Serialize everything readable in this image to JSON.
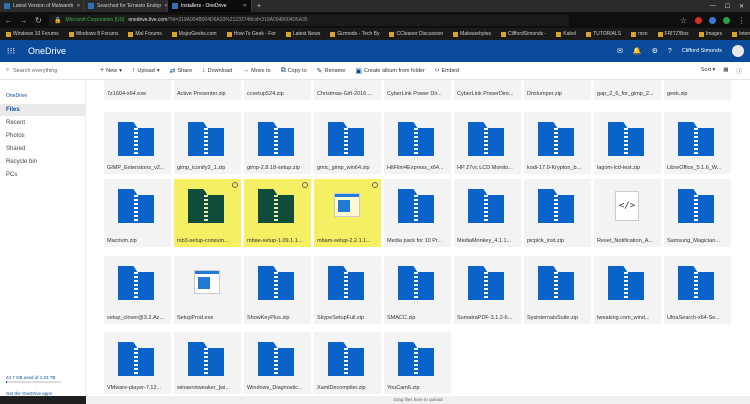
{
  "browser": {
    "tabs": [
      {
        "label": "Latest Version of Malwareb",
        "active": false
      },
      {
        "label": "Searched for 'Ernesto Endop",
        "active": false
      },
      {
        "label": "Installers - OneDrive",
        "active": true
      }
    ],
    "secure_label": "Microsoft Corporation [US]",
    "url_host": "onedrive.live.com",
    "url_path": "/?id=319A004B004D6A33%21232748cid=319A0048004D6A35",
    "bookmarks": [
      "Windows 10 Forums",
      "Windows 8 Forums",
      "Mal Forums",
      "MajorGeeks.com",
      "How-To Geek - For",
      "Latest News",
      "Gizmodo - Tech By",
      "CCleaner Discussion",
      "Malwarebytes",
      "CliffordSimonds -",
      "Kabel",
      "TUTORIALS",
      "msn",
      "FRITZ!Box",
      "Images",
      "Internet Archive"
    ]
  },
  "onedrive": {
    "brand": "OneDrive",
    "user": "Clifford Simonds",
    "search_placeholder": "Search everything",
    "commands": [
      {
        "icon": "+",
        "label": "New",
        "caret": true
      },
      {
        "icon": "↑",
        "label": "Upload",
        "caret": true
      },
      {
        "icon": "⇄",
        "label": "Share"
      },
      {
        "icon": "↓",
        "label": "Download"
      },
      {
        "icon": "→",
        "label": "Move to"
      },
      {
        "icon": "⧉",
        "label": "Copy to"
      },
      {
        "icon": "✎",
        "label": "Rename"
      },
      {
        "icon": "▣",
        "label": "Create album from folder"
      },
      {
        "icon": "‹›",
        "label": "Embed"
      }
    ],
    "sort_label": "Sort",
    "sidebar": {
      "title": "OneDrive",
      "items": [
        "Files",
        "Recent",
        "Photos",
        "Shared",
        "Recycle bin",
        "PCs"
      ],
      "active": "Files",
      "storage_text": "24.7 GB used of 1.03 TB",
      "storage_fraction": 0.024,
      "get_apps": "Get the OneDrive apps"
    },
    "footer_text": "Drag files here to upload",
    "files": [
      {
        "name": "7z1604-x64.exe",
        "type": "none"
      },
      {
        "name": "Active Presenter.zip",
        "type": "none"
      },
      {
        "name": "ccsetup524.zip",
        "type": "none"
      },
      {
        "name": "Christmas-Gift-2016....",
        "type": "none"
      },
      {
        "name": "CyberLink Power Dir...",
        "type": "none"
      },
      {
        "name": "CyberLink PowerDire...",
        "type": "none"
      },
      {
        "name": "Dnslumper.zip",
        "type": "none"
      },
      {
        "name": "gap_2_6_for_gimp_2...",
        "type": "none"
      },
      {
        "name": "geek.zip",
        "type": "none"
      },
      {
        "name": "GIMP_Extensions_v2...",
        "type": "zip"
      },
      {
        "name": "gimp_iconify2_1.zip",
        "type": "zip"
      },
      {
        "name": "gimp-2.8.18-setup.zip",
        "type": "zip"
      },
      {
        "name": "gmic_gimp_win64.zip",
        "type": "zip"
      },
      {
        "name": "HitFilm4Express_x64...",
        "type": "zip"
      },
      {
        "name": "HP 27vc LCD Monito...",
        "type": "zip"
      },
      {
        "name": "kodi-17.0-Krypton_b...",
        "type": "zip"
      },
      {
        "name": "lagom-lcd-test.zip",
        "type": "zip"
      },
      {
        "name": "LibreOffice_5.1.6_W...",
        "type": "zip"
      },
      {
        "name": "Macrium.zip",
        "type": "zip"
      },
      {
        "name": "mb3-setup-consum...",
        "type": "zip",
        "selected": true
      },
      {
        "name": "mbae-setup-1.09.1.1...",
        "type": "zip",
        "selected": true
      },
      {
        "name": "mbam-setup-2.2.1.1...",
        "type": "exe",
        "selected": true
      },
      {
        "name": "Media pack for 10 Pr...",
        "type": "zip"
      },
      {
        "name": "MediaMonkey_4.1.1...",
        "type": "zip"
      },
      {
        "name": "picpick_inst.zip",
        "type": "zip"
      },
      {
        "name": "Reset_Notification_A...",
        "type": "code"
      },
      {
        "name": "Samsung_Magician...",
        "type": "zip"
      },
      {
        "name": "setup_clover@3.2.Az...",
        "type": "zip"
      },
      {
        "name": "SetupProd.exe",
        "type": "exe"
      },
      {
        "name": "ShowKeyPlus.zip",
        "type": "zip"
      },
      {
        "name": "SkypeSetupFull.zip",
        "type": "zip"
      },
      {
        "name": "SMACC.zip",
        "type": "zip"
      },
      {
        "name": "SumatraPDF-3.1.2-6...",
        "type": "zip"
      },
      {
        "name": "SysinternalsSuite.zip",
        "type": "zip"
      },
      {
        "name": "tweaking.com_wind...",
        "type": "zip"
      },
      {
        "name": "UltraSearch-x64-Se...",
        "type": "zip"
      },
      {
        "name": "VMware-player-7.12...",
        "type": "zip"
      },
      {
        "name": "winaerotweaker_[wi...",
        "type": "zip"
      },
      {
        "name": "Windows_Diagnostic...",
        "type": "zip"
      },
      {
        "name": "XamlDecompiler.zip",
        "type": "zip"
      },
      {
        "name": "YouCam6.zip",
        "type": "zip"
      }
    ]
  }
}
